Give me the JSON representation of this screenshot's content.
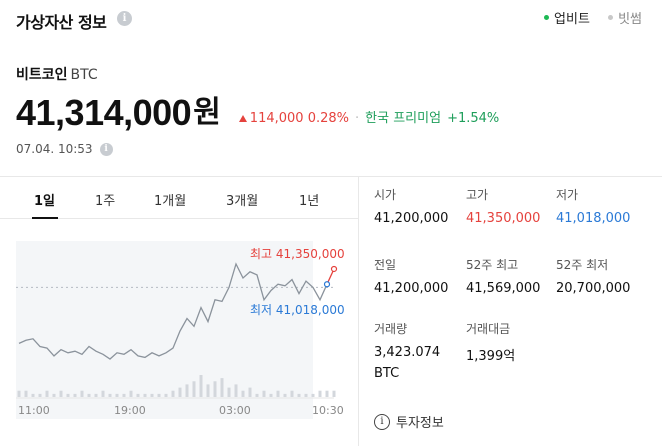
{
  "header": {
    "title": "가상자산 정보",
    "info_icon": "info-circle-icon",
    "sources": [
      {
        "label": "업비트",
        "active": true
      },
      {
        "label": "빗썸",
        "active": false
      }
    ]
  },
  "coin": {
    "name": "비트코인",
    "ticker": "BTC",
    "price": "41,314,000",
    "unit": "원",
    "change_amount": "114,000",
    "change_rate": "0.28%",
    "premium_label": "한국 프리미엄",
    "premium_value": "+1.54%",
    "timestamp": "07.04. 10:53"
  },
  "period_tabs": [
    "1일",
    "1주",
    "1개월",
    "3개월",
    "1년"
  ],
  "active_period": "1일",
  "chart_data": {
    "type": "line",
    "x_tick_labels": [
      "11:00",
      "19:00",
      "03:00",
      "10:30"
    ],
    "high_label": "최고 41,350,000",
    "low_label": "최저 41,018,000",
    "high": 41350000,
    "low": 41018000,
    "reference": 41200000,
    "price_series": [
      40840000,
      40860000,
      40870000,
      40820000,
      40810000,
      40760000,
      40800000,
      40780000,
      40790000,
      40770000,
      40820000,
      40790000,
      40770000,
      40740000,
      40780000,
      40770000,
      40800000,
      40760000,
      40750000,
      40780000,
      40760000,
      40780000,
      40810000,
      40920000,
      41000000,
      40950000,
      41070000,
      40980000,
      41120000,
      41110000,
      41200000,
      41350000,
      41260000,
      41300000,
      41280000,
      41120000,
      41180000,
      41220000,
      41210000,
      41250000,
      41160000,
      41240000,
      41200000,
      41120000,
      41220000,
      41318000
    ],
    "volume_series": [
      2,
      2,
      1,
      1,
      2,
      1,
      2,
      1,
      1,
      2,
      1,
      1,
      2,
      1,
      1,
      1,
      2,
      1,
      1,
      1,
      1,
      1,
      2,
      3,
      4,
      5,
      7,
      4,
      5,
      6,
      3,
      4,
      2,
      3,
      1,
      2,
      1,
      2,
      1,
      2,
      1,
      1,
      1,
      2,
      2,
      2
    ]
  },
  "stats": [
    {
      "label": "시가",
      "value": "41,200,000",
      "tone": "normal"
    },
    {
      "label": "고가",
      "value": "41,350,000",
      "tone": "red"
    },
    {
      "label": "저가",
      "value": "41,018,000",
      "tone": "blue"
    },
    {
      "label": "전일",
      "value": "41,200,000",
      "tone": "normal"
    },
    {
      "label": "52주 최고",
      "value": "41,569,000",
      "tone": "normal"
    },
    {
      "label": "52주 최저",
      "value": "20,700,000",
      "tone": "normal"
    },
    {
      "label": "거래량",
      "value": "3,423.074",
      "value2": "BTC",
      "tone": "normal"
    },
    {
      "label": "거래대금",
      "value": "1,399억",
      "tone": "normal"
    }
  ],
  "invest_info": {
    "label": "투자정보",
    "icon": "info-icon"
  },
  "colors": {
    "up": "#e5423d",
    "down": "#2b7ad6",
    "line": "#8b939c",
    "accent_green": "#1e9e5a",
    "chart_bg": "#f4f6f8"
  }
}
